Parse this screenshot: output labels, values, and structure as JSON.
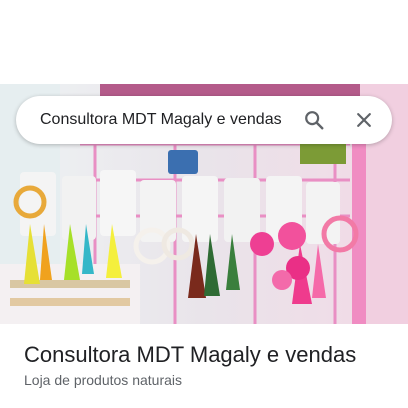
{
  "search": {
    "query": "Consultora MDT Magaly e vendas",
    "search_icon": "search-icon",
    "clear_icon": "close-icon"
  },
  "photo": {
    "subject": "earrings-display-photo"
  },
  "place": {
    "title": "Consultora MDT Magaly e vendas",
    "category": "Loja de produtos naturais"
  },
  "colors": {
    "title_text": "#202124",
    "secondary_text": "#5f6368",
    "icon": "#5f6368"
  }
}
